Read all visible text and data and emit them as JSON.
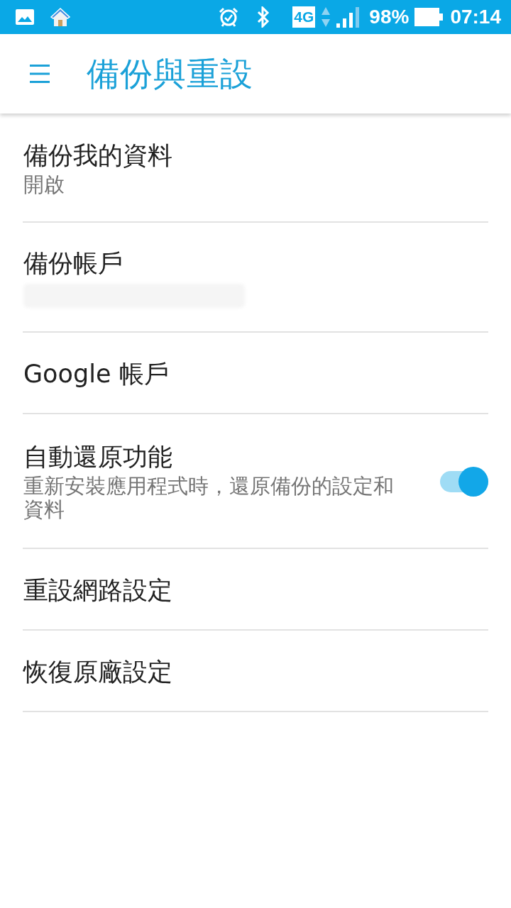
{
  "status_bar": {
    "network": "4G",
    "battery": "98%",
    "time": "07:14"
  },
  "toolbar": {
    "title": "備份與重設"
  },
  "settings": [
    {
      "kind": "text",
      "title": "備份我的資料",
      "summary": "開啟"
    },
    {
      "kind": "redacted",
      "title": "備份帳戶"
    },
    {
      "kind": "text",
      "title": "Google 帳戶"
    },
    {
      "kind": "switch",
      "title": "自動還原功能",
      "summary": "重新安裝應用程式時，還原備份的設定和資料",
      "on": true
    },
    {
      "kind": "text",
      "title": "重設網路設定"
    },
    {
      "kind": "text",
      "title": "恢復原廠設定"
    }
  ]
}
